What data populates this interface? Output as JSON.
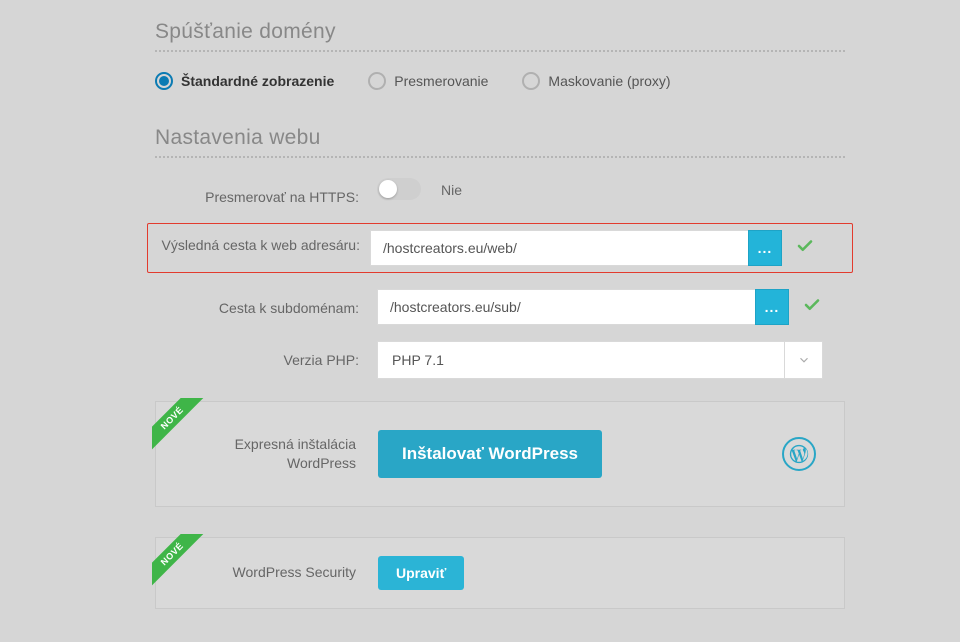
{
  "sections": {
    "domain_launch_title": "Spúšťanie domény",
    "web_settings_title": "Nastavenia webu"
  },
  "radios": {
    "standard": "Štandardné zobrazenie",
    "redirect": "Presmerovanie",
    "mask": "Maskovanie (proxy)"
  },
  "https": {
    "label": "Presmerovať na HTTPS:",
    "state_label": "Nie"
  },
  "web_path": {
    "label": "Výsledná cesta k web adresáru:",
    "value": "/hostcreators.eu/web/",
    "browse": "..."
  },
  "sub_path": {
    "label": "Cesta k subdoménam:",
    "value": "/hostcreators.eu/sub/",
    "browse": "..."
  },
  "php": {
    "label": "Verzia PHP:",
    "value": "PHP 7.1"
  },
  "wp_install": {
    "ribbon": "NOVÉ",
    "label": "Expresná inštalácia WordPress",
    "button": "Inštalovať WordPress"
  },
  "wp_security": {
    "ribbon": "NOVÉ",
    "label": "WordPress Security",
    "button": "Upraviť"
  }
}
